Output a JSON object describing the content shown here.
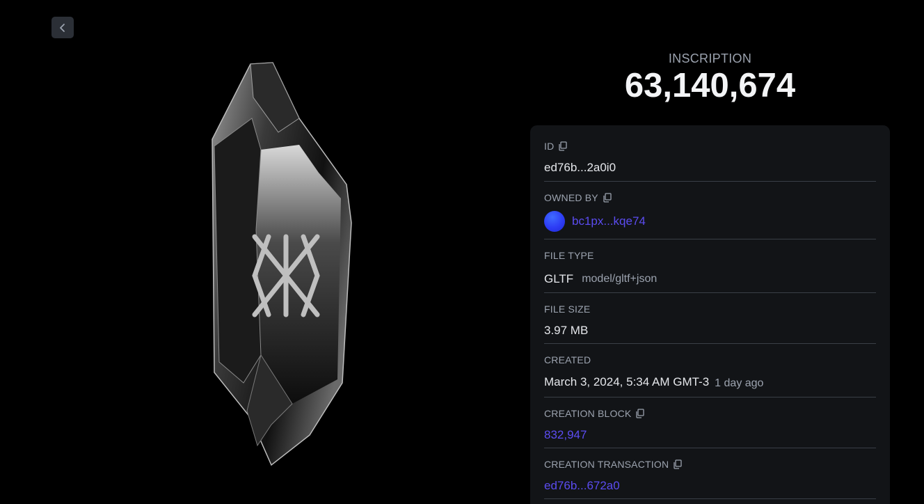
{
  "header": {
    "kicker": "INSCRIPTION",
    "number": "63,140,674"
  },
  "details": {
    "id": {
      "label": "ID",
      "value": "ed76b...2a0i0"
    },
    "owned_by": {
      "label": "OWNED BY",
      "value": "bc1px...kqe74"
    },
    "file_type": {
      "label": "FILE TYPE",
      "value": "GLTF",
      "mime": "model/gltf+json"
    },
    "file_size": {
      "label": "FILE SIZE",
      "value": "3.97 MB"
    },
    "created": {
      "label": "CREATED",
      "value": "March 3, 2024, 5:34 AM GMT-3",
      "relative": "1 day ago"
    },
    "creation_block": {
      "label": "CREATION BLOCK",
      "value": "832,947"
    },
    "creation_transaction": {
      "label": "CREATION TRANSACTION",
      "value": "ed76b...672a0"
    }
  },
  "icons": {
    "back": "chevron-left-icon",
    "copy": "copy-icon"
  },
  "colors": {
    "background": "#000000",
    "card": "#121417",
    "link": "#5b4cf0",
    "muted": "#9ca3af"
  }
}
